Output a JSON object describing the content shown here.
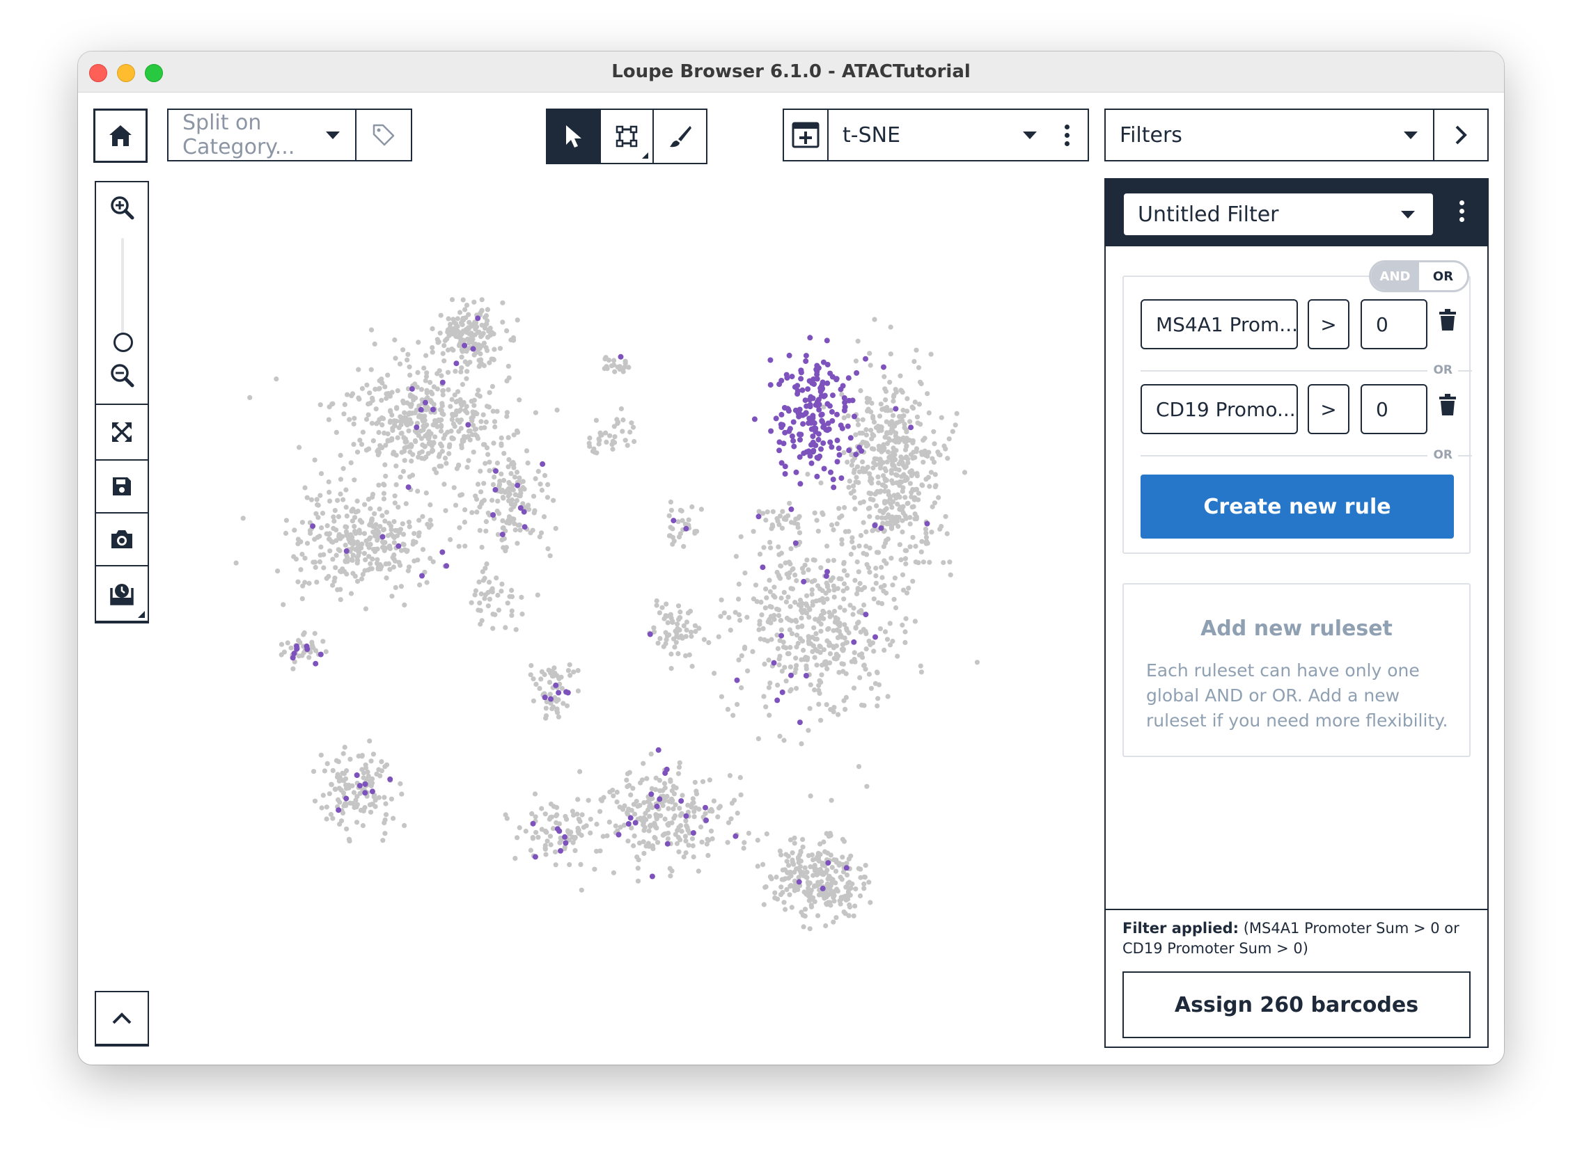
{
  "window": {
    "title": "Loupe Browser 6.1.0 - ATACTutorial"
  },
  "toolbar": {
    "home_icon": "home-icon",
    "split_placeholder": "Split on Category...",
    "tag_icon": "tag-icon",
    "tools": [
      {
        "name": "select-pointer",
        "icon": "cursor-icon",
        "active": true
      },
      {
        "name": "lasso-rectangle",
        "icon": "rectangle-select-icon",
        "active": false
      },
      {
        "name": "brush",
        "icon": "brush-icon",
        "active": false
      }
    ],
    "projection_icon": "projection-add-icon",
    "projection_label": "t-SNE",
    "filters_label": "Filters"
  },
  "sidebar": {
    "items": [
      "zoom-in-icon",
      "zoom-out-icon",
      "expand-icon",
      "save-icon",
      "camera-icon",
      "screenshot-icon"
    ]
  },
  "plot": {
    "colors": {
      "background_cell": "#c5c5c5",
      "highlighted_cell": "#7d52bd"
    }
  },
  "filter_panel": {
    "filter_name": "Untitled Filter",
    "logic_toggle": {
      "and": "AND",
      "or": "OR",
      "selected": "OR"
    },
    "rules": [
      {
        "feature": "MS4A1 Prom...",
        "operator": ">",
        "value": "0"
      },
      {
        "feature": "CD19 Promo...",
        "operator": ">",
        "value": "0"
      }
    ],
    "separator": "OR",
    "create_rule_label": "Create new rule",
    "add_ruleset_title": "Add new ruleset",
    "add_ruleset_text": "Each ruleset can have only one global AND or OR. Add a new ruleset if you need more flexibility.",
    "applied_label": "Filter applied:",
    "applied_text": "(MS4A1 Promoter Sum > 0 or CD19 Promoter Sum > 0)",
    "assign_label": "Assign 260 barcodes"
  },
  "colors": {
    "navy": "#1e2a3a",
    "primary_blue": "#2677c9",
    "muted_text": "#8fa0b3"
  }
}
